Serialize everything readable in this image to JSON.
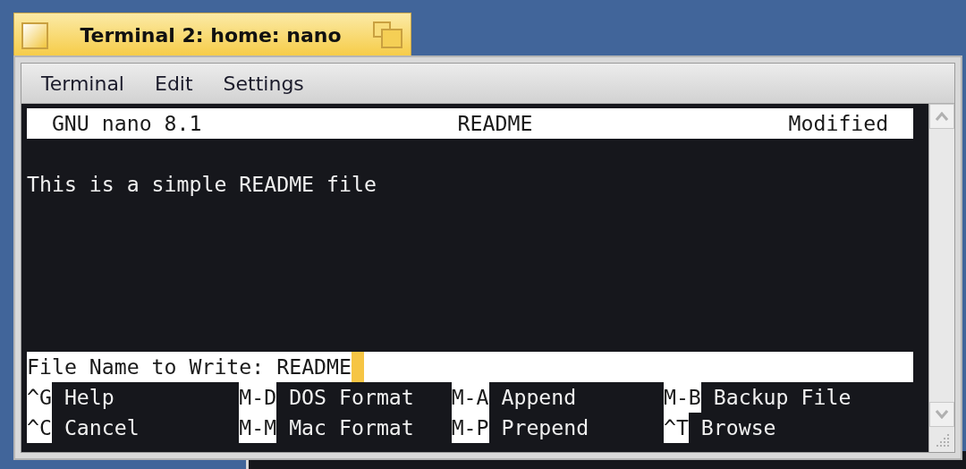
{
  "window": {
    "title": "Terminal 2: home: nano",
    "active": true
  },
  "menu": [
    {
      "label": "Terminal"
    },
    {
      "label": "Edit"
    },
    {
      "label": "Settings"
    }
  ],
  "nano": {
    "title_bar": {
      "version": "GNU nano 8.1",
      "filename": "README",
      "status": "Modified"
    },
    "lines": [
      "This is a simple README file"
    ],
    "prompt": {
      "label": "File Name to Write:",
      "value": "README"
    },
    "shortcuts": [
      [
        {
          "key": "^G",
          "label": "Help"
        },
        {
          "key": "M-D",
          "label": "DOS Format"
        },
        {
          "key": "M-A",
          "label": "Append"
        },
        {
          "key": "M-B",
          "label": "Backup File"
        }
      ],
      [
        {
          "key": "^C",
          "label": "Cancel"
        },
        {
          "key": "M-M",
          "label": "Mac Format"
        },
        {
          "key": "M-P",
          "label": "Prepend"
        },
        {
          "key": "^T",
          "label": "Browse"
        }
      ]
    ]
  }
}
